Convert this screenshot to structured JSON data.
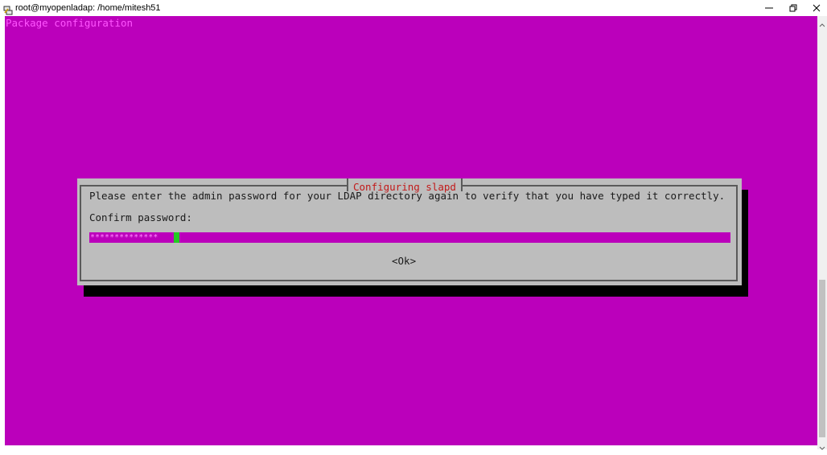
{
  "window": {
    "title": "root@myopenladap: /home/mitesh51",
    "minimize_icon": "minimize-icon",
    "restore_icon": "restore-icon",
    "close_icon": "close-icon"
  },
  "terminal": {
    "header": "Package configuration",
    "background_color": "#bb00bb"
  },
  "dialog": {
    "title": "Configuring slapd",
    "prompt": "Please enter the admin password for your LDAP directory again to verify that you have typed it correctly.",
    "field_label": "Confirm password:",
    "password_mask": "**************",
    "ok_label": "<Ok>"
  }
}
